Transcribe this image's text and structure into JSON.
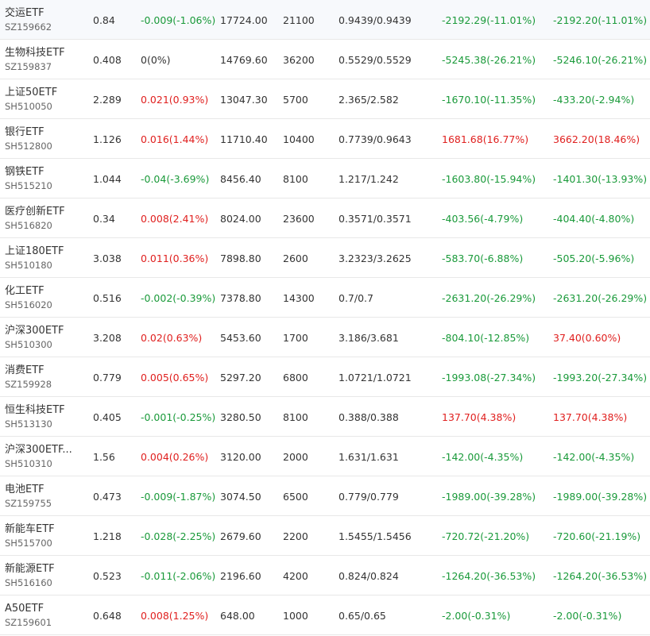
{
  "colors": {
    "up": "#e0201f",
    "down": "#1a9a3a",
    "flat": "#333333",
    "divider": "#e8e8e8"
  },
  "holdings": [
    {
      "name": "交运ETF",
      "code": "SZ159662",
      "price": "0.84",
      "change": "-0.009(-1.06%)",
      "change_dir": "down",
      "market_value": "17724.00",
      "shares": "21100",
      "cost": "0.9439/0.9439",
      "pnl": "-2192.29(-11.01%)",
      "pnl_dir": "down",
      "pnl2": "-2192.20(-11.01%)",
      "pnl2_dir": "down"
    },
    {
      "name": "生物科技ETF",
      "code": "SZ159837",
      "price": "0.408",
      "change": "0(0%)",
      "change_dir": "flat",
      "market_value": "14769.60",
      "shares": "36200",
      "cost": "0.5529/0.5529",
      "pnl": "-5245.38(-26.21%)",
      "pnl_dir": "down",
      "pnl2": "-5246.10(-26.21%)",
      "pnl2_dir": "down"
    },
    {
      "name": "上证50ETF",
      "code": "SH510050",
      "price": "2.289",
      "change": "0.021(0.93%)",
      "change_dir": "up",
      "market_value": "13047.30",
      "shares": "5700",
      "cost": "2.365/2.582",
      "pnl": "-1670.10(-11.35%)",
      "pnl_dir": "down",
      "pnl2": "-433.20(-2.94%)",
      "pnl2_dir": "down"
    },
    {
      "name": "银行ETF",
      "code": "SH512800",
      "price": "1.126",
      "change": "0.016(1.44%)",
      "change_dir": "up",
      "market_value": "11710.40",
      "shares": "10400",
      "cost": "0.7739/0.9643",
      "pnl": "1681.68(16.77%)",
      "pnl_dir": "up",
      "pnl2": "3662.20(18.46%)",
      "pnl2_dir": "up"
    },
    {
      "name": "钢铁ETF",
      "code": "SH515210",
      "price": "1.044",
      "change": "-0.04(-3.69%)",
      "change_dir": "down",
      "market_value": "8456.40",
      "shares": "8100",
      "cost": "1.217/1.242",
      "pnl": "-1603.80(-15.94%)",
      "pnl_dir": "down",
      "pnl2": "-1401.30(-13.93%)",
      "pnl2_dir": "down"
    },
    {
      "name": "医疗创新ETF",
      "code": "SH516820",
      "price": "0.34",
      "change": "0.008(2.41%)",
      "change_dir": "up",
      "market_value": "8024.00",
      "shares": "23600",
      "cost": "0.3571/0.3571",
      "pnl": "-403.56(-4.79%)",
      "pnl_dir": "down",
      "pnl2": "-404.40(-4.80%)",
      "pnl2_dir": "down"
    },
    {
      "name": "上证180ETF",
      "code": "SH510180",
      "price": "3.038",
      "change": "0.011(0.36%)",
      "change_dir": "up",
      "market_value": "7898.80",
      "shares": "2600",
      "cost": "3.2323/3.2625",
      "pnl": "-583.70(-6.88%)",
      "pnl_dir": "down",
      "pnl2": "-505.20(-5.96%)",
      "pnl2_dir": "down"
    },
    {
      "name": "化工ETF",
      "code": "SH516020",
      "price": "0.516",
      "change": "-0.002(-0.39%)",
      "change_dir": "down",
      "market_value": "7378.80",
      "shares": "14300",
      "cost": "0.7/0.7",
      "pnl": "-2631.20(-26.29%)",
      "pnl_dir": "down",
      "pnl2": "-2631.20(-26.29%)",
      "pnl2_dir": "down"
    },
    {
      "name": "沪深300ETF",
      "code": "SH510300",
      "price": "3.208",
      "change": "0.02(0.63%)",
      "change_dir": "up",
      "market_value": "5453.60",
      "shares": "1700",
      "cost": "3.186/3.681",
      "pnl": "-804.10(-12.85%)",
      "pnl_dir": "down",
      "pnl2": "37.40(0.60%)",
      "pnl2_dir": "up"
    },
    {
      "name": "消费ETF",
      "code": "SZ159928",
      "price": "0.779",
      "change": "0.005(0.65%)",
      "change_dir": "up",
      "market_value": "5297.20",
      "shares": "6800",
      "cost": "1.0721/1.0721",
      "pnl": "-1993.08(-27.34%)",
      "pnl_dir": "down",
      "pnl2": "-1993.20(-27.34%)",
      "pnl2_dir": "down"
    },
    {
      "name": "恒生科技ETF",
      "code": "SH513130",
      "price": "0.405",
      "change": "-0.001(-0.25%)",
      "change_dir": "down",
      "market_value": "3280.50",
      "shares": "8100",
      "cost": "0.388/0.388",
      "pnl": "137.70(4.38%)",
      "pnl_dir": "up",
      "pnl2": "137.70(4.38%)",
      "pnl2_dir": "up"
    },
    {
      "name": "沪深300ETF...",
      "code": "SH510310",
      "price": "1.56",
      "change": "0.004(0.26%)",
      "change_dir": "up",
      "market_value": "3120.00",
      "shares": "2000",
      "cost": "1.631/1.631",
      "pnl": "-142.00(-4.35%)",
      "pnl_dir": "down",
      "pnl2": "-142.00(-4.35%)",
      "pnl2_dir": "down"
    },
    {
      "name": "电池ETF",
      "code": "SZ159755",
      "price": "0.473",
      "change": "-0.009(-1.87%)",
      "change_dir": "down",
      "market_value": "3074.50",
      "shares": "6500",
      "cost": "0.779/0.779",
      "pnl": "-1989.00(-39.28%)",
      "pnl_dir": "down",
      "pnl2": "-1989.00(-39.28%)",
      "pnl2_dir": "down"
    },
    {
      "name": "新能车ETF",
      "code": "SH515700",
      "price": "1.218",
      "change": "-0.028(-2.25%)",
      "change_dir": "down",
      "market_value": "2679.60",
      "shares": "2200",
      "cost": "1.5455/1.5456",
      "pnl": "-720.72(-21.20%)",
      "pnl_dir": "down",
      "pnl2": "-720.60(-21.19%)",
      "pnl2_dir": "down"
    },
    {
      "name": "新能源ETF",
      "code": "SH516160",
      "price": "0.523",
      "change": "-0.011(-2.06%)",
      "change_dir": "down",
      "market_value": "2196.60",
      "shares": "4200",
      "cost": "0.824/0.824",
      "pnl": "-1264.20(-36.53%)",
      "pnl_dir": "down",
      "pnl2": "-1264.20(-36.53%)",
      "pnl2_dir": "down"
    },
    {
      "name": "A50ETF",
      "code": "SZ159601",
      "price": "0.648",
      "change": "0.008(1.25%)",
      "change_dir": "up",
      "market_value": "648.00",
      "shares": "1000",
      "cost": "0.65/0.65",
      "pnl": "-2.00(-0.31%)",
      "pnl_dir": "down",
      "pnl2": "-2.00(-0.31%)",
      "pnl2_dir": "down"
    }
  ]
}
